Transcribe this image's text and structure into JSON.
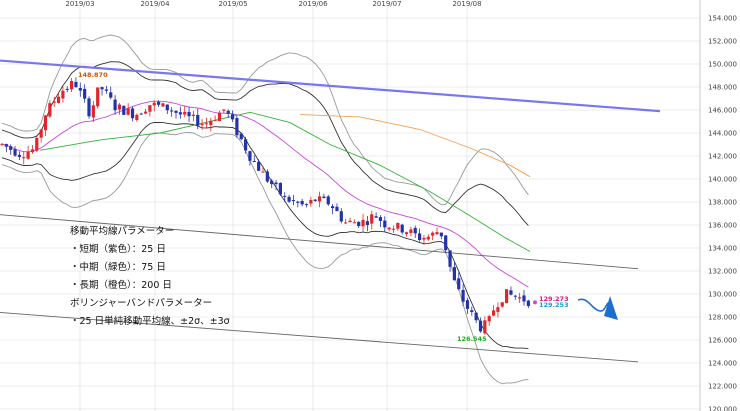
{
  "chart_data": {
    "type": "candlestick",
    "x_tick_labels": [
      "2019/03",
      "2019/04",
      "2019/05",
      "2019/06",
      "2019/07",
      "2019/08"
    ],
    "y_ticks": [
      120,
      122,
      124,
      126,
      128,
      130,
      132,
      134,
      136,
      138,
      140,
      142,
      144,
      146,
      148,
      150,
      152,
      154
    ],
    "y_tick_labels": [
      "120.000",
      "122.000",
      "124.000",
      "126.000",
      "128.000",
      "130.000",
      "132.000",
      "134.000",
      "136.000",
      "138.000",
      "140.000",
      "142.000",
      "144.000",
      "146.000",
      "148.000",
      "150.000",
      "152.000",
      "154.000"
    ],
    "ylim": [
      120,
      155
    ],
    "legend_lines": [
      "移動平均線パラメーター",
      "・短期（紫色）：25 日",
      "・中期（緑色）：75 日",
      "・長期（橙色）：200 日",
      "ボリンジャーバンドパラメーター",
      "・25 日単純移動平均線、±2σ、±3σ"
    ],
    "annotations": [
      {
        "text": "148.870",
        "value": 148.87,
        "color": "#d45500"
      },
      {
        "text": "126.545",
        "value": 126.545,
        "color": "#22aa22"
      },
      {
        "text": "129.273",
        "value": 129.273,
        "color": "#e0147a"
      },
      {
        "text": "129.253",
        "value": 129.253,
        "color": "#1a9fd0"
      }
    ],
    "colors": {
      "up": "#e0262b",
      "down": "#2233aa",
      "ma_short": "#cc44dd",
      "ma_mid": "#33b233",
      "ma_long": "#f0a050",
      "bb2": "#333333",
      "bb3": "#999999",
      "trend_blue": "#7777ee",
      "channel": "#666666",
      "arrow": "#1a6fd0"
    }
  }
}
